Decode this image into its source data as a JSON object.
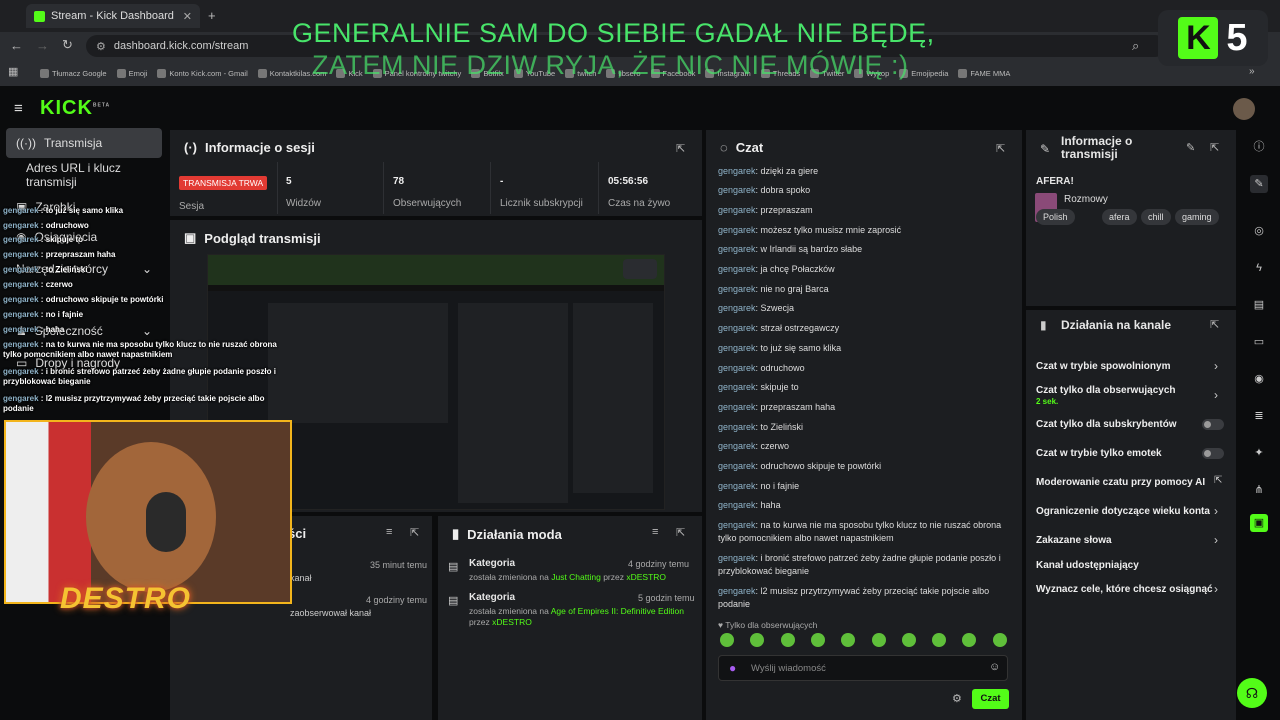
{
  "browser": {
    "tab_title": "Stream - Kick Dashboard",
    "url": "dashboard.kick.com/stream",
    "bookmarks": [
      "Tłumacz Google",
      "Emoji",
      "Konto Kick.com - Gmail",
      "Kontaktkilas.com",
      "Kick",
      "Panel kontrolny twitchy",
      "Botfilx",
      "YouTube",
      "twitch",
      "libsero",
      "Facebook",
      "Instagram",
      "Threads",
      "Twitter",
      "Wykop",
      "Emojipedia",
      "FAME MMA"
    ]
  },
  "overlay": {
    "line1": "GENERALNIE SAM DO SIEBIE GADAŁ NIE BĘDĘ,",
    "line2": "ZATEM NIE DZIW RYJA, ŻE NIC NIE MÓWIĘ :)",
    "badge_number": "5",
    "badge_k": "K"
  },
  "kick": {
    "logo": "KICK",
    "beta": "BETA"
  },
  "sidebar": {
    "items": [
      {
        "label": "Transmisja"
      },
      {
        "label": "Adres URL i klucz transmisji"
      },
      {
        "label": "Zarobki"
      },
      {
        "label": "Osiągnięcia"
      },
      {
        "label": "Narzędzia twórcy"
      },
      {
        "label": "Społeczność"
      },
      {
        "label": "Dropy i nagrody"
      }
    ]
  },
  "session": {
    "title": "Informacje o sesji",
    "live_label": "TRANSMISJA TRWA",
    "session_label": "Sesja",
    "stats": [
      {
        "value": "5",
        "label": "Widzów"
      },
      {
        "value": "78",
        "label": "Obserwujących"
      },
      {
        "value": "-",
        "label": "Licznik subskrypcji"
      },
      {
        "value": "05:56:56",
        "label": "Czas na żywo"
      }
    ]
  },
  "preview": {
    "title": "Podgląd transmisji"
  },
  "overlay_chat": [
    {
      "user": "gengarek",
      "text": "to już się samo klika"
    },
    {
      "user": "gengarek",
      "text": "odruchowo"
    },
    {
      "user": "gengarek",
      "text": "skipuje to"
    },
    {
      "user": "gengarek",
      "text": "przepraszam haha"
    },
    {
      "user": "gengarek",
      "text": "to Zieliński"
    },
    {
      "user": "gengarek",
      "text": "czerwo"
    },
    {
      "user": "gengarek",
      "text": "odruchowo skipuje te powtórki"
    },
    {
      "user": "gengarek",
      "text": "no i fajnie"
    },
    {
      "user": "gengarek",
      "text": "haha"
    },
    {
      "user": "gengarek",
      "text": "na to kurwa nie ma sposobu tylko klucz to nie ruszać obrona tylko pomocnikiem albo nawet napastnikiem"
    },
    {
      "user": "gengarek",
      "text": "i bronić strefowo patrzeć żeby żadne głupie podanie poszło i przyblokować bieganie"
    },
    {
      "user": "gengarek",
      "text": "l2 musisz przytrzymywać żeby przeciąć takie pojscie albo podanie"
    }
  ],
  "webcam": {
    "name": "DESTRO"
  },
  "events": {
    "title": "ści",
    "rows": [
      {
        "time": "35 minut temu",
        "text": "kanał"
      },
      {
        "time": "4 godziny temu",
        "text": "zaobserwował kanał"
      }
    ]
  },
  "mod_actions": {
    "title": "Działania moda",
    "rows": [
      {
        "title": "Kategoria",
        "time": "4 godziny temu",
        "pre": "została zmieniona na ",
        "cat": "Just Chatting",
        "mid": " przez ",
        "by": "xDESTRO"
      },
      {
        "title": "Kategoria",
        "time": "5 godzin temu",
        "pre": "została zmieniona na ",
        "cat": "Age of Empires II: Definitive Edition",
        "mid": " przez ",
        "by": "xDESTRO"
      }
    ]
  },
  "chat": {
    "title": "Czat",
    "messages": [
      {
        "user": "gengarek",
        "text": "dzięki za giere"
      },
      {
        "user": "gengarek",
        "text": "dobra spoko"
      },
      {
        "user": "gengarek",
        "text": "przepraszam"
      },
      {
        "user": "gengarek",
        "text": "możesz tylko musisz mnie zaprosić"
      },
      {
        "user": "gengarek",
        "text": "w Irlandii są bardzo słabe"
      },
      {
        "user": "gengarek",
        "text": "ja chcę Połaczków"
      },
      {
        "user": "gengarek",
        "text": "nie no graj Barca"
      },
      {
        "user": "gengarek",
        "text": "Szwecja"
      },
      {
        "user": "gengarek",
        "text": "strzał ostrzegawczy"
      },
      {
        "user": "gengarek",
        "text": "to już się samo klika"
      },
      {
        "user": "gengarek",
        "text": "odruchowo"
      },
      {
        "user": "gengarek",
        "text": "skipuje to"
      },
      {
        "user": "gengarek",
        "text": "przepraszam haha"
      },
      {
        "user": "gengarek",
        "text": "to Zieliński"
      },
      {
        "user": "gengarek",
        "text": "czerwo"
      },
      {
        "user": "gengarek",
        "text": "odruchowo skipuje te powtórki"
      },
      {
        "user": "gengarek",
        "text": "no i fajnie"
      },
      {
        "user": "gengarek",
        "text": "haha"
      },
      {
        "user": "gengarek",
        "text": "na to kurwa nie ma sposobu tylko klucz to nie ruszać obrona tylko pomocnikiem albo nawet napastnikiem"
      },
      {
        "user": "gengarek",
        "text": "i bronić strefowo patrzeć żeby żadne głupie podanie poszło i przyblokować bieganie"
      },
      {
        "user": "gengarek",
        "text": "l2 musisz przytrzymywać żeby przeciąć takie pojscie albo podanie"
      }
    ],
    "followers_only": "Tylko dla obserwujących",
    "input_placeholder": "Wyślij wiadomość",
    "send_label": "Czat"
  },
  "stream_info": {
    "title": "Informacje o transmisji",
    "stream_title": "AFERA!",
    "category": "Rozmowy",
    "tags": [
      "Polish",
      "afera",
      "chill",
      "gaming"
    ]
  },
  "channel_actions": {
    "title": "Działania na kanale",
    "items": [
      {
        "label": "Czat w trybie spowolnionym",
        "sub": "",
        "control": "chevron"
      },
      {
        "label": "Czat tylko dla obserwujących",
        "sub": "2 sek.",
        "control": "chevron"
      },
      {
        "label": "Czat tylko dla subskrybentów",
        "sub": "",
        "control": "toggle"
      },
      {
        "label": "Czat w trybie tylko emotek",
        "sub": "",
        "control": "toggle"
      },
      {
        "label": "Moderowanie czatu przy pomocy AI",
        "sub": "",
        "control": "external"
      },
      {
        "label": "Ograniczenie dotyczące wieku konta",
        "sub": "",
        "control": "chevron"
      },
      {
        "label": "Zakazane słowa",
        "sub": "",
        "control": "chevron"
      },
      {
        "label": "Kanał udostępniający",
        "sub": "",
        "control": "none"
      },
      {
        "label": "Wyznacz cele, które chcesz osiągnąć",
        "sub": "",
        "control": "chevron"
      }
    ]
  },
  "colors": {
    "brand": "#53fc18",
    "live": "#e23a33",
    "username": "#8fb3c9"
  }
}
